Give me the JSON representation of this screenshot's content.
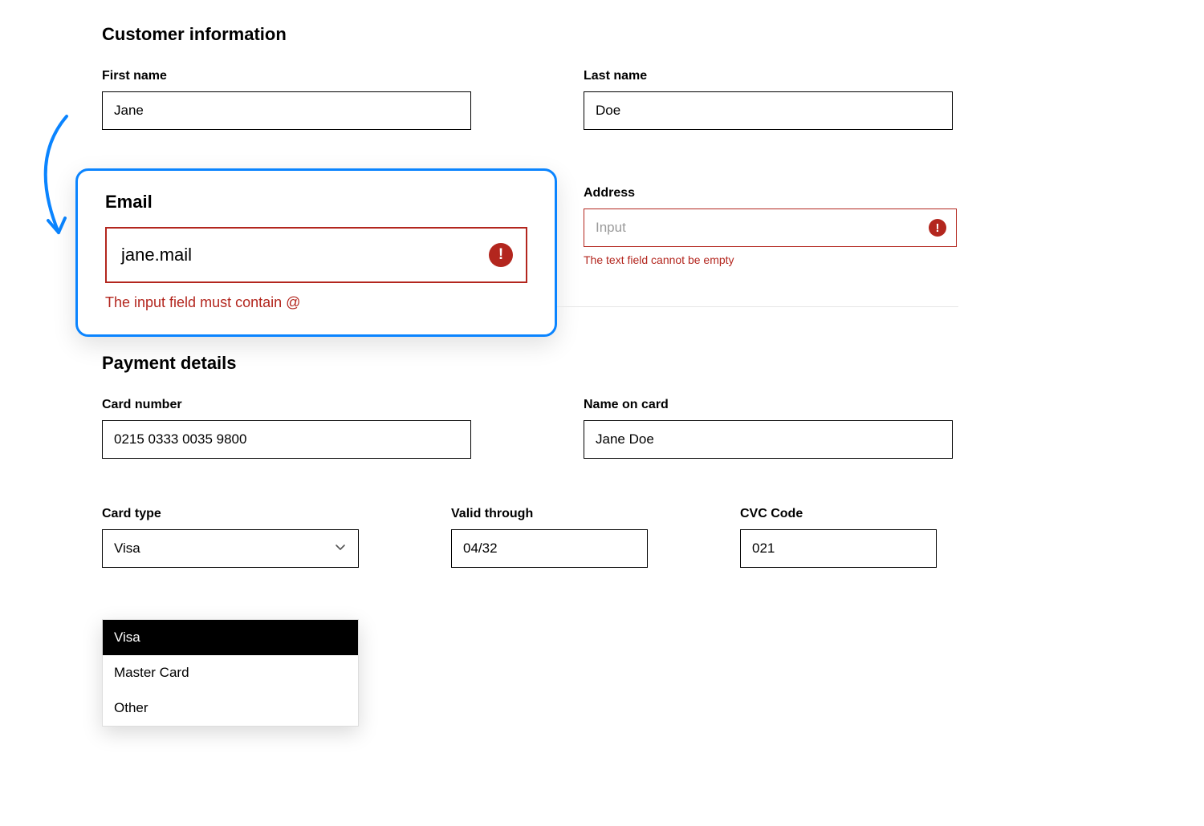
{
  "customer": {
    "section_title": "Customer information",
    "first_name_label": "First name",
    "first_name_value": "Jane",
    "last_name_label": "Last name",
    "last_name_value": "Doe",
    "email_label": "Email",
    "email_value": "jane.mail",
    "email_error": "The input field must contain @",
    "address_label": "Address",
    "address_placeholder": "Input",
    "address_error": "The text field cannot be empty"
  },
  "payment": {
    "section_title": "Payment details",
    "card_number_label": "Card number",
    "card_number_value": "0215 0333 0035 9800",
    "name_on_card_label": "Name on card",
    "name_on_card_value": "Jane Doe",
    "card_type_label": "Card type",
    "card_type_value": "Visa",
    "card_type_options": [
      "Visa",
      "Master Card",
      "Other"
    ],
    "valid_through_label": "Valid through",
    "valid_through_value": "04/32",
    "cvc_code_label": "CVC Code",
    "cvc_code_value": "021"
  },
  "colors": {
    "error": "#b3261e",
    "highlight": "#0a84ff"
  }
}
